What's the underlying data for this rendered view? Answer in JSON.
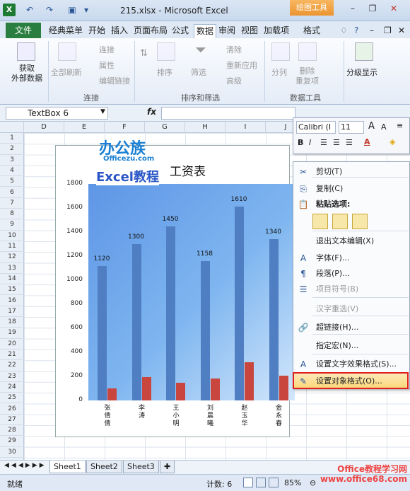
{
  "window": {
    "title": "215.xlsx - Microsoft Excel",
    "context_tab_header": "绘图工具"
  },
  "tabs": [
    "文件",
    "经典菜单",
    "开始",
    "插入",
    "页面布局",
    "公式",
    "数据",
    "审阅",
    "视图",
    "加载项",
    "格式"
  ],
  "ribbon": {
    "get_external": "获取\n外部数据",
    "refresh_all": "全部刷新",
    "connections": "连接",
    "properties": "属性",
    "edit_links": "编辑链接",
    "group_connections": "连接",
    "sort": "排序",
    "filter": "筛选",
    "clear": "清除",
    "reapply": "重新应用",
    "advanced": "高级",
    "group_sort_filter": "排序和筛选",
    "text_to_columns": "分列",
    "remove_duplicates": "删除\n重复项",
    "group_data_tools": "数据工具",
    "outline": "分级显示"
  },
  "formula_bar": {
    "name_box": "TextBox 6",
    "fx": "fx",
    "value": ""
  },
  "columns": [
    "D",
    "E",
    "F",
    "G",
    "H",
    "I",
    "J"
  ],
  "rows": [
    "1",
    "2",
    "3",
    "4",
    "5",
    "6",
    "7",
    "8",
    "9",
    "10",
    "11",
    "12",
    "13",
    "14",
    "15",
    "16",
    "17",
    "18",
    "19",
    "20",
    "21",
    "22",
    "23",
    "24",
    "25",
    "26",
    "27",
    "28",
    "29",
    "30"
  ],
  "logo": {
    "line1": "办公族",
    "line2": "Officezu.com",
    "line3": "Excel教程"
  },
  "chart_data": {
    "type": "bar",
    "title": "工资表",
    "categories": [
      "张倩倩",
      "李涛",
      "王小明",
      "刘晨曦",
      "赵玉华",
      "金永春"
    ],
    "series": [
      {
        "values": [
          1120,
          1300,
          1450,
          1158,
          1610,
          1340
        ]
      },
      {
        "values": [
          100,
          195,
          145,
          180,
          320,
          205
        ]
      }
    ],
    "ylim": [
      0,
      1800
    ],
    "yticks": [
      "0",
      "200",
      "400",
      "600",
      "800",
      "1000",
      "1200",
      "1400",
      "1600",
      "1800"
    ],
    "colors": [
      "#4f7ec2",
      "#c9463f"
    ]
  },
  "mini_toolbar": {
    "font": "Calibri (I",
    "size": "11"
  },
  "context_menu": [
    {
      "label": "剪切(T)",
      "icon": "cut-icon",
      "enabled": true
    },
    {
      "label": "复制(C)",
      "icon": "copy-icon",
      "enabled": true
    },
    {
      "label": "粘贴选项:",
      "icon": "paste-icon",
      "enabled": true
    },
    {
      "label": "退出文本编辑(X)",
      "icon": "",
      "enabled": true
    },
    {
      "label": "字体(F)...",
      "icon": "font-icon",
      "enabled": true
    },
    {
      "label": "段落(P)...",
      "icon": "paragraph-icon",
      "enabled": true
    },
    {
      "label": "项目符号(B)",
      "icon": "bullets-icon",
      "enabled": false
    },
    {
      "label": "汉字重选(V)",
      "icon": "",
      "enabled": false
    },
    {
      "label": "超链接(H)...",
      "icon": "hyperlink-icon",
      "enabled": true
    },
    {
      "label": "指定宏(N)...",
      "icon": "",
      "enabled": true
    },
    {
      "label": "设置文字效果格式(S)...",
      "icon": "text-effects-icon",
      "enabled": true
    },
    {
      "label": "设置对象格式(O)...",
      "icon": "format-object-icon",
      "enabled": true
    }
  ],
  "sheets": [
    "Sheet1",
    "Sheet2",
    "Sheet3"
  ],
  "status": {
    "ready": "就绪",
    "count": "计数: 6",
    "zoom": "85%"
  },
  "watermark": "Office教程学习网\nwww.office68.com"
}
